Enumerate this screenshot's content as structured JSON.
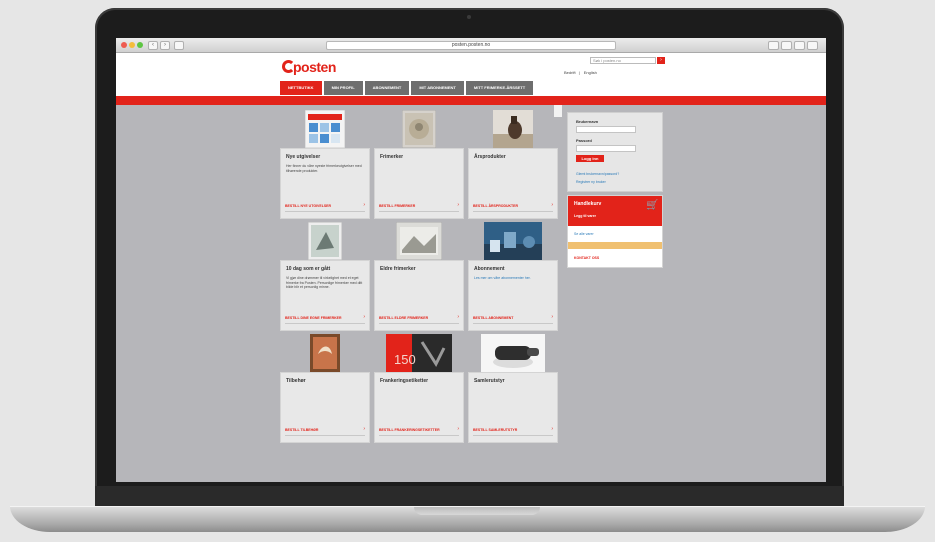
{
  "browser": {
    "url": "posten.posten.no"
  },
  "header": {
    "logo_text": "posten",
    "search_placeholder": "Søk i posten.no",
    "toplinks": [
      "Bedrift",
      "English"
    ]
  },
  "nav": {
    "tabs": [
      {
        "label": "NETTBUTIKK",
        "active": true
      },
      {
        "label": "MIN PROFIL",
        "active": false
      },
      {
        "label": "ABONNEMENT",
        "active": false
      },
      {
        "label": "MIT ABONNEMENT",
        "active": false
      },
      {
        "label": "MITT FRIMERKE-ÅRSSETT",
        "active": false
      }
    ]
  },
  "cards": [
    {
      "title": "Nye utgivelser",
      "desc": "Her finner du våre nyeste frimerkeutgivelser med tilhørende produkter.",
      "link": "BESTILL NYE UTGIVELSER"
    },
    {
      "title": "Frimerker",
      "desc": "",
      "link": "BESTILL FRIMERKER"
    },
    {
      "title": "Årsprodukter",
      "desc": "",
      "link": "BESTILL ÅRSPRODUKTER"
    },
    {
      "title": "10 dag som er gått",
      "desc": "Vi gjør dine drømmer til virkelighet med et eget frimerke fra Posten. Personlige frimerker med ditt bilde blir et personlig minne.",
      "link": "BESTILL DINE EGNE FRIMERKER"
    },
    {
      "title": "Eldre frimerker",
      "desc": "",
      "link": "BESTILL ELDRE FRIMERKER"
    },
    {
      "title": "Abonnement",
      "desc": "Les mer om våre abonnementer her.",
      "link": "BESTILL ABONNEMENT"
    },
    {
      "title": "Tilbehør",
      "desc": "",
      "link": "BESTILL TILBEHØR"
    },
    {
      "title": "Frankeringsetiketter",
      "desc": "",
      "link": "BESTILL FRANKERINGSETIKETTER"
    },
    {
      "title": "Samlerutstyr",
      "desc": "",
      "link": "BESTILL SAMLERUTSTYR"
    }
  ],
  "login": {
    "username_label": "Brukernavn",
    "password_label": "Passord",
    "button_label": "Logg inn",
    "link1": "Glemt brukernavn/passord?",
    "link2": "Registrer ny bruker"
  },
  "cart": {
    "title": "Handlekurv",
    "subtitle": "Legg til varer",
    "link": "Se alle varer",
    "footer": "KONTAKT OSS"
  },
  "colors": {
    "brand_red": "#e2231a",
    "nav_gray": "#6e6e6e"
  }
}
